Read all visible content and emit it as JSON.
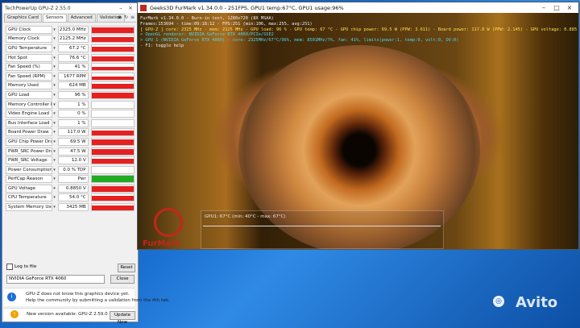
{
  "gpuz": {
    "title": "TechPowerUp GPU-Z 2.55.0",
    "tabs": [
      "Graphics Card",
      "Sensors",
      "Advanced",
      "Validation"
    ],
    "active_tab": "Sensors",
    "sensors": [
      {
        "label": "GPU Clock",
        "value": "2325.0 MHz",
        "level": 0.82,
        "color": "#e52020"
      },
      {
        "label": "Memory Clock",
        "value": "2125.2 MHz",
        "level": 0.82,
        "color": "#e52020"
      },
      {
        "label": "GPU Temperature",
        "value": "67.2 °C",
        "level": 0.72,
        "color": "#e52020"
      },
      {
        "label": "Hot Spot",
        "value": "76.6 °C",
        "level": 0.72,
        "color": "#e52020"
      },
      {
        "label": "Fan Speed (%)",
        "value": "41 %",
        "level": 0.5,
        "color": "#e52020"
      },
      {
        "label": "Fan Speed (RPM)",
        "value": "1677 RPM",
        "level": 0.5,
        "color": "#e52020"
      },
      {
        "label": "Memory Used",
        "value": "624 MB",
        "level": 0.85,
        "color": "#e52020"
      },
      {
        "label": "GPU Load",
        "value": "96 %",
        "level": 0.85,
        "color": "#e52020"
      },
      {
        "label": "Memory Controller Load",
        "value": "1 %",
        "level": 0.0,
        "color": "#e52020"
      },
      {
        "label": "Video Engine Load",
        "value": "0 %",
        "level": 0.0,
        "color": "#e52020"
      },
      {
        "label": "Bus Interface Load",
        "value": "1 %",
        "level": 0.0,
        "color": "#e52020"
      },
      {
        "label": "Board Power Draw",
        "value": "117.0 W",
        "level": 0.82,
        "color": "#e52020"
      },
      {
        "label": "GPU Chip Power Draw",
        "value": "69.5 W",
        "level": 0.82,
        "color": "#e52020"
      },
      {
        "label": "PWR_SRC Power Draw",
        "value": "47.5 W",
        "level": 0.82,
        "color": "#e52020"
      },
      {
        "label": "PWR_SRC Voltage",
        "value": "12.0 V",
        "level": 0.82,
        "color": "#e52020"
      },
      {
        "label": "Power Consumption (%)",
        "value": "0.0 % TDP",
        "level": 0.0,
        "color": "#e52020"
      },
      {
        "label": "PerfCap Reason",
        "value": "Pwr",
        "level": 1.0,
        "color": "#22aa22"
      },
      {
        "label": "GPU Voltage",
        "value": "0.8850 V",
        "level": 0.82,
        "color": "#e52020"
      },
      {
        "label": "CPU Temperature",
        "value": "54.0 °C",
        "level": 0.82,
        "color": "#e52020"
      },
      {
        "label": "System Memory Used",
        "value": "3425 MB",
        "level": 0.82,
        "color": "#e52020"
      }
    ],
    "log_to_file": "Log to file",
    "reset": "Reset",
    "gpu_select": "NVIDIA GeForce RTX 4060",
    "close": "Close",
    "notice_line1": "GPU-Z does not know this graphics device yet.",
    "notice_line2": "Help the community by submitting a validation from the 4th tab.",
    "update_text": "New version available: GPU-Z 2.59.0",
    "update_button": "Update Now"
  },
  "furmark": {
    "title": "Geeks3D FurMark v1.34.0.0 - 251FPS, GPU1 temp:67°C, GPU1 usage:96%",
    "osd": [
      {
        "text": "FurMark v1.34.0.0 - Burn-in test, 1280x720 (8X MSAA)",
        "color": "white"
      },
      {
        "text": "Frames:153694 - time:09:18:12 - FPS:251 (min:106, max:255, avg:251)",
        "color": "white"
      },
      {
        "text": "[ GPU-Z ] core: 2325 MHz - mem: 2125 MHz - GPU load: 96 % - GPU temp: 67 °C - GPU chip power: 69.5 W (PPW: 3.611) - Board power: 117.0 W (PPW: 2.145) - GPU voltage: 0.885 V",
        "color": "yellow"
      },
      {
        "text": "> OpenGL renderer: NVIDIA GeForce RTX 4060/PCIe/SSE2",
        "color": "cyan"
      },
      {
        "text": "> GPU 1 (NVIDIA GeForce RTX 4060) - core: 2325MHz/67°C/96%, mem: 8501MHz/7%, fan: 41%, limits(power:1, temp:0, volt:0, OV:0)",
        "color": "cyan"
      },
      {
        "text": "- F1: toggle help",
        "color": "white"
      }
    ],
    "graph_label": "GPU1: 67°C (min: 40°C - max: 67°C)",
    "brand": "FurMark"
  },
  "watermark": "Avito"
}
